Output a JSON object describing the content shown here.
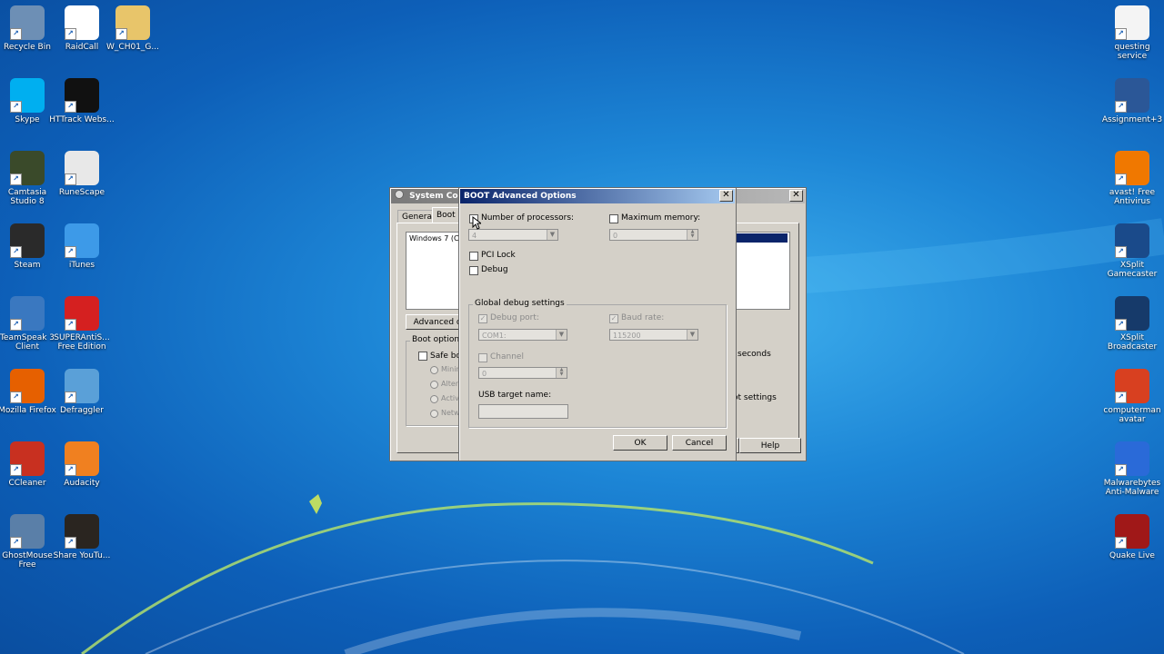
{
  "desktop_icons_left": [
    {
      "label": "Recycle Bin",
      "icon": "recycle-bin-icon",
      "color": "#6d8fb5"
    },
    {
      "label": "RaidCall",
      "icon": "raidcall-icon",
      "color": "#ffffff"
    },
    {
      "label": "W_CH01_G...",
      "icon": "folder-icon",
      "color": "#e8c56a"
    },
    {
      "label": "Skype",
      "icon": "skype-icon",
      "color": "#00aff0"
    },
    {
      "label": "HTTrack Webs...",
      "icon": "httrack-icon",
      "color": "#111111"
    },
    {
      "label": "Camtasia Studio 8",
      "icon": "camtasia-icon",
      "color": "#3a4a2a"
    },
    {
      "label": "RuneScape",
      "icon": "runescape-icon",
      "color": "#e8e8e8"
    },
    {
      "label": "Steam",
      "icon": "steam-icon",
      "color": "#2a2a2a"
    },
    {
      "label": "iTunes",
      "icon": "itunes-icon",
      "color": "#3d9ae8"
    },
    {
      "label": "TeamSpeak 3 Client",
      "icon": "teamspeak-icon",
      "color": "#3a78c0"
    },
    {
      "label": "SUPERAntiS... Free Edition",
      "icon": "superantispyware-icon",
      "color": "#d52020"
    },
    {
      "label": "Mozilla Firefox",
      "icon": "firefox-icon",
      "color": "#e66000"
    },
    {
      "label": "Defraggler",
      "icon": "defraggler-icon",
      "color": "#5aa0d8"
    },
    {
      "label": "CCleaner",
      "icon": "ccleaner-icon",
      "color": "#c83020"
    },
    {
      "label": "Audacity",
      "icon": "audacity-icon",
      "color": "#f08020"
    },
    {
      "label": "GhostMouse Free",
      "icon": "ghostmouse-icon",
      "color": "#5a7fa8"
    },
    {
      "label": "Share YouTu...",
      "icon": "syv-icon",
      "color": "#2a2520"
    }
  ],
  "desktop_icons_right": [
    {
      "label": "questing service",
      "icon": "document-icon",
      "color": "#f4f4f4"
    },
    {
      "label": "Assignment+3",
      "icon": "word-document-icon",
      "color": "#2b5797"
    },
    {
      "label": "avast! Free Antivirus",
      "icon": "avast-icon",
      "color": "#f07800"
    },
    {
      "label": "XSplit Gamecaster",
      "icon": "xsplit-gamecaster-icon",
      "color": "#1a4a8a"
    },
    {
      "label": "XSplit Broadcaster",
      "icon": "xsplit-broadcaster-icon",
      "color": "#163a6a"
    },
    {
      "label": "computerman avatar",
      "icon": "image-file-icon",
      "color": "#d84020"
    },
    {
      "label": "Malwarebytes Anti-Malware",
      "icon": "malwarebytes-icon",
      "color": "#2a6ad8"
    },
    {
      "label": "Quake Live",
      "icon": "quake-icon",
      "color": "#a01818"
    }
  ],
  "syscfg": {
    "title": "System Confi",
    "tabs": [
      "General",
      "Boot"
    ],
    "os_entry": "Windows 7 (C",
    "advanced_button": "Advanced o",
    "boot_options_title": "Boot options",
    "safe_boot": "Safe boo",
    "radio_labels": [
      "Minim",
      "Alter",
      "Activ",
      "Netw"
    ],
    "seconds_text": "seconds",
    "settings_text": "ot settings",
    "help_button": "Help"
  },
  "boot_dialog": {
    "title": "BOOT Advanced Options",
    "number_of_processors": "Number of processors:",
    "processors_value": "4",
    "maximum_memory": "Maximum memory:",
    "memory_value": "0",
    "pci_lock": "PCI Lock",
    "debug": "Debug",
    "global_debug_title": "Global debug settings",
    "debug_port": "Debug port:",
    "debug_port_value": "COM1:",
    "baud_rate": "Baud rate:",
    "baud_rate_value": "115200",
    "channel": "Channel",
    "channel_value": "0",
    "usb_target_name": "USB target name:",
    "ok": "OK",
    "cancel": "Cancel"
  },
  "colors": {
    "titlebar_active": "#0a246a",
    "titlebar_active_end": "#a6caf0",
    "titlebar_inactive": "#808080",
    "selection": "#0a246a"
  }
}
